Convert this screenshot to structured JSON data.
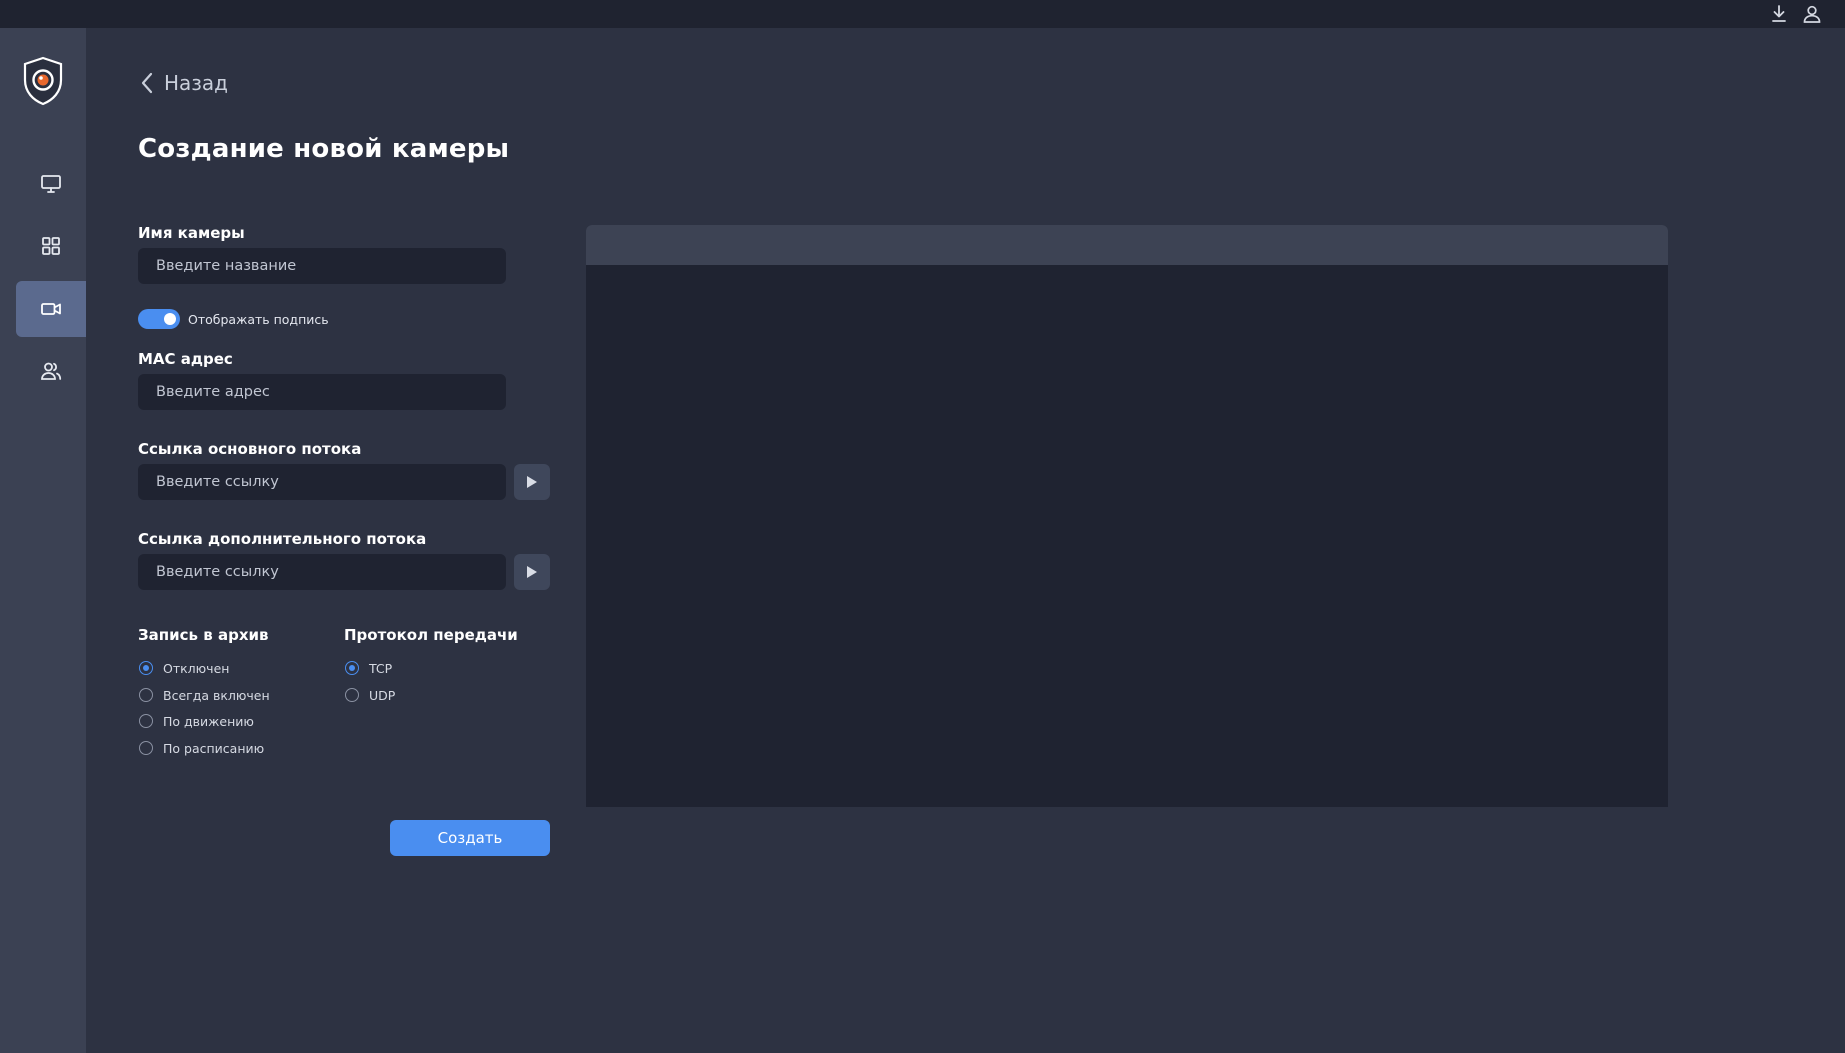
{
  "nav": {
    "back_label": "Назад"
  },
  "page": {
    "title": "Создание новой камеры"
  },
  "form": {
    "camera_name": {
      "label": "Имя камеры",
      "placeholder": "Введите название",
      "value": ""
    },
    "show_caption": {
      "label": "Отображать подпись",
      "checked": true
    },
    "mac_address": {
      "label": "MAC адрес",
      "placeholder": "Введите адрес",
      "value": ""
    },
    "main_stream": {
      "label": "Ссылка основного потока",
      "placeholder": "Введите ссылку",
      "value": ""
    },
    "sub_stream": {
      "label": "Ссылка дополнительного потока",
      "placeholder": "Введите ссылку",
      "value": ""
    },
    "archive": {
      "title": "Запись в архив",
      "options": [
        "Отключен",
        "Всегда включен",
        "По движению",
        "По расписанию"
      ],
      "selected": "Отключен"
    },
    "protocol": {
      "title": "Протокол передачи",
      "options": [
        "TCP",
        "UDP"
      ],
      "selected": "TCP"
    },
    "submit_label": "Создать"
  },
  "colors": {
    "accent": "#4a8ef0",
    "background": "#2d3242",
    "sidebar": "#3b4153",
    "input": "#1f2331",
    "logo_accent": "#e8672c"
  },
  "icons": {
    "topbar": [
      "download-icon",
      "user-icon"
    ],
    "sidebar": [
      "shield-logo-icon",
      "monitor-icon",
      "grid-icon",
      "camera-icon",
      "users-icon"
    ],
    "back": "chevron-left-icon",
    "play": "play-icon"
  }
}
